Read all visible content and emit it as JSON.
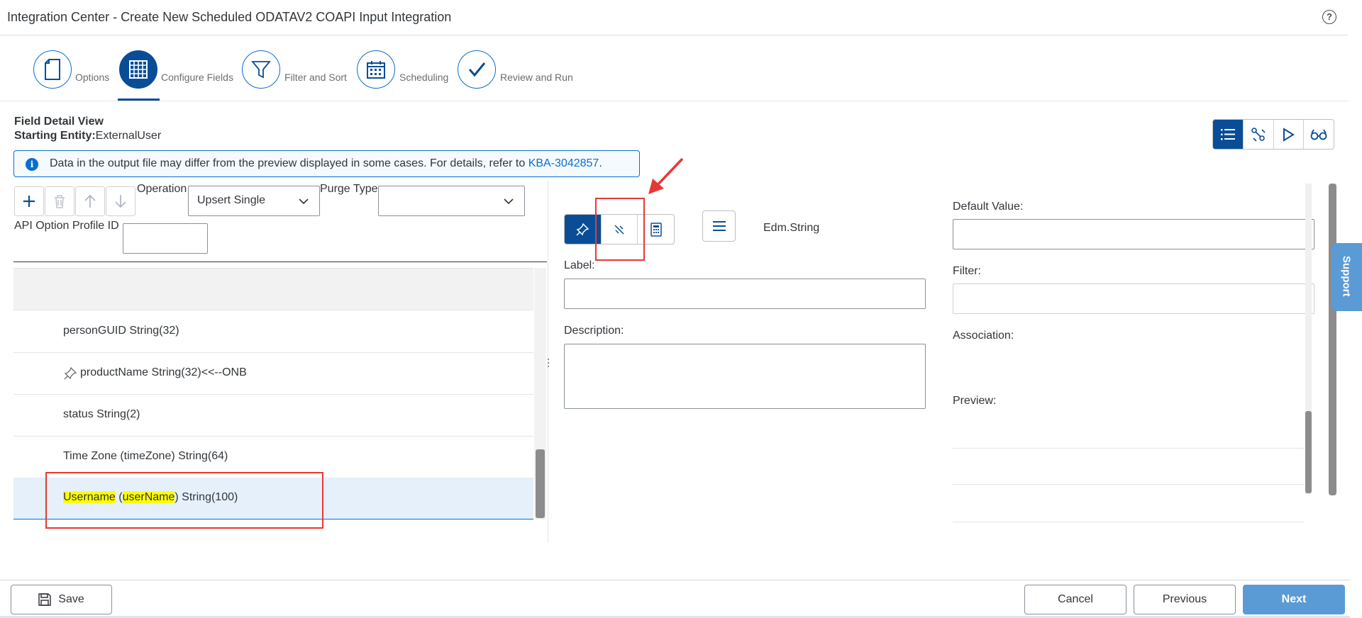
{
  "header": {
    "title": "Integration Center - Create New Scheduled ODATAV2 COAPI Input Integration",
    "help_icon": "?"
  },
  "wizard": {
    "steps": [
      {
        "label": "Options",
        "icon": "document-icon"
      },
      {
        "label": "Configure Fields",
        "icon": "grid-icon",
        "active": true
      },
      {
        "label": "Filter and Sort",
        "icon": "funnel-icon"
      },
      {
        "label": "Scheduling",
        "icon": "calendar-icon"
      },
      {
        "label": "Review and Run",
        "icon": "checkmark-icon"
      }
    ]
  },
  "field_detail": {
    "title": "Field Detail View",
    "entity_label": "Starting Entity:",
    "entity_value": "ExternalUser"
  },
  "info": {
    "icon": "i",
    "text": "Data in the output file may differ from the preview displayed in some cases. For details, refer to ",
    "link": "KBA-3042857",
    "suffix": "."
  },
  "toolbar": {
    "operation_label": "Operation",
    "operation_value": "Upsert Single",
    "purge_label": "Purge Type",
    "purge_value": "",
    "api_profile_label": "API Option Profile ID",
    "api_profile_value": ""
  },
  "fields": [
    {
      "text": "personGUID String(32)"
    },
    {
      "text": "productName String(32)<<--ONB",
      "pinned": true
    },
    {
      "text": "status String(2)"
    },
    {
      "text": "Time Zone (timeZone) String(64)"
    },
    {
      "label_part": "Username",
      "open": " (",
      "name_part": "userName",
      "rest": ") String(100)",
      "selected": true
    }
  ],
  "middle": {
    "type": "Edm.String",
    "label_label": "Label:",
    "label_value": "",
    "description_label": "Description:",
    "description_value": ""
  },
  "right": {
    "default_value_label": "Default Value:",
    "default_value": "",
    "filter_label": "Filter:",
    "filter_value": "",
    "association_label": "Association:",
    "preview_label": "Preview:"
  },
  "side_tab": "Support",
  "footer": {
    "save": "Save",
    "cancel": "Cancel",
    "previous": "Previous",
    "next": "Next"
  },
  "colors": {
    "brand": "#0a4d97",
    "accent": "#0a6ed1",
    "annotation": "#e53935",
    "highlight": "#ffff00",
    "primary_button": "#5b9bd5"
  }
}
